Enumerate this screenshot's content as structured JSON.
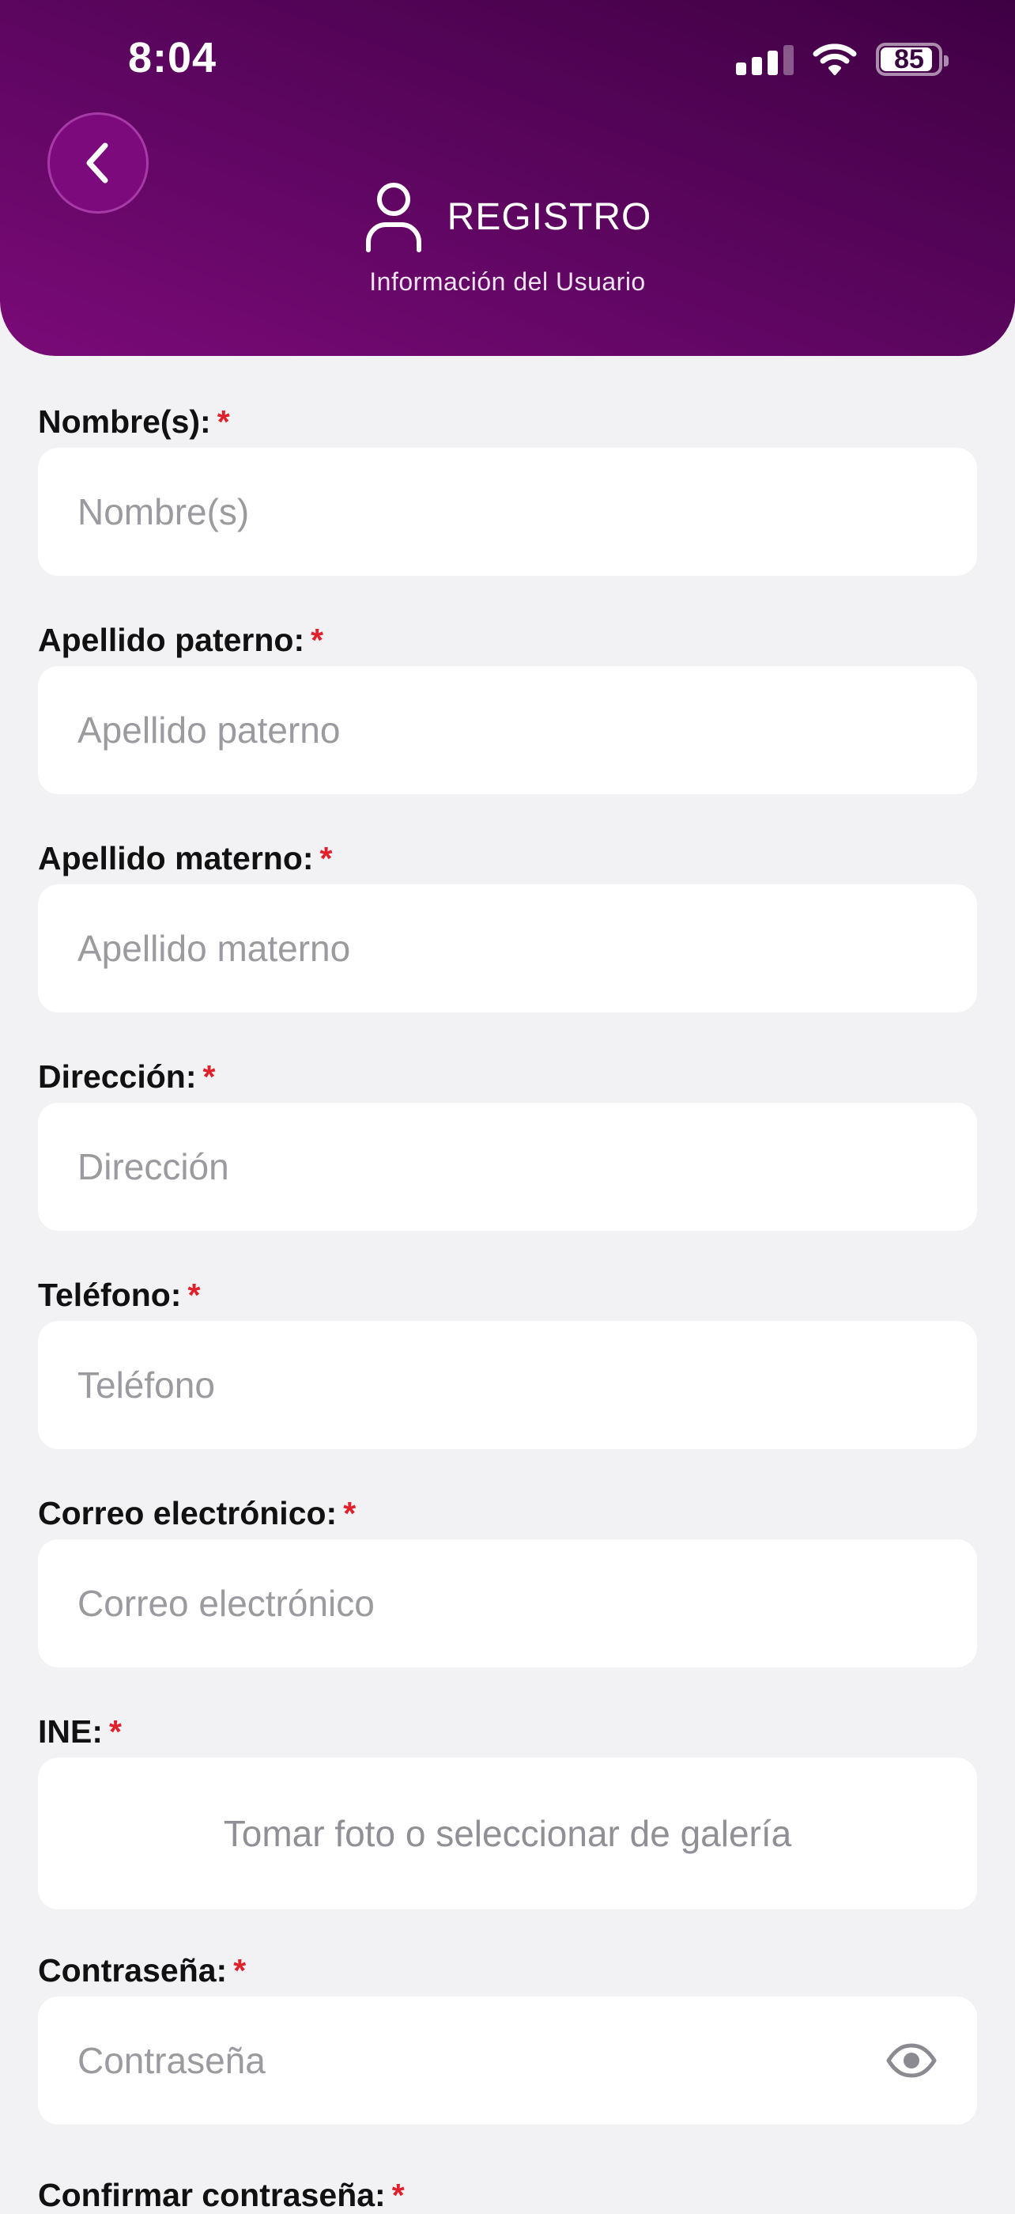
{
  "status_bar": {
    "time": "8:04",
    "battery": "85"
  },
  "header": {
    "title": "REGISTRO",
    "subtitle": "Información del Usuario"
  },
  "form": {
    "required_mark": "*",
    "nombre": {
      "label": "Nombre(s):",
      "placeholder": "Nombre(s)"
    },
    "apellido_paterno": {
      "label": "Apellido paterno:",
      "placeholder": "Apellido paterno"
    },
    "apellido_materno": {
      "label": "Apellido materno:",
      "placeholder": "Apellido materno"
    },
    "direccion": {
      "label": "Dirección:",
      "placeholder": "Dirección"
    },
    "telefono": {
      "label": "Teléfono:",
      "placeholder": "Teléfono"
    },
    "correo": {
      "label": "Correo electrónico:",
      "placeholder": "Correo electrónico"
    },
    "ine": {
      "label": "INE:",
      "upload_text": "Tomar foto o seleccionar de galería"
    },
    "contrasena": {
      "label": "Contraseña:",
      "placeholder": "Contraseña"
    },
    "confirmar_cutoff": "Confirmar contraseña:"
  },
  "colors": {
    "header_primary": "#6a0a6c",
    "header_dark": "#3f0043",
    "required": "#e0212b",
    "background": "#f2f2f5"
  },
  "icons": {
    "back": "chevron-left-icon",
    "user": "user-icon",
    "password_toggle": "eye-icon"
  }
}
